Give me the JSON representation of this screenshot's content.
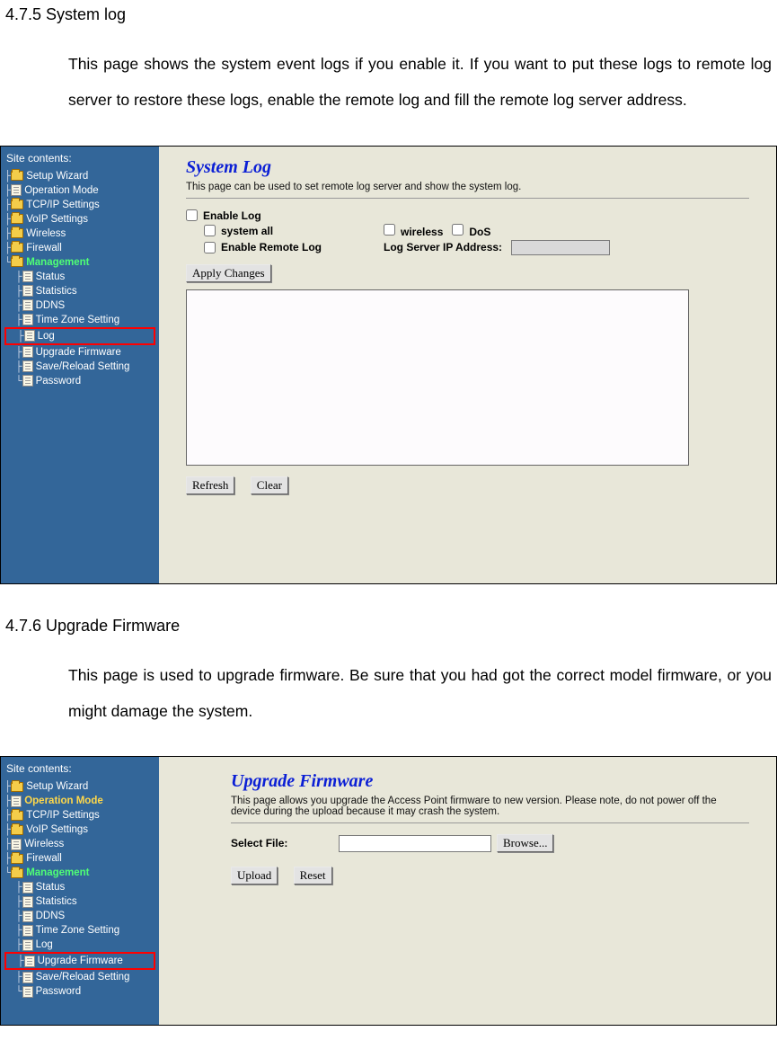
{
  "section1": {
    "heading": "4.7.5 System log",
    "body": "This page shows the system event logs if you enable it. If you want to put these logs to remote log server to restore these logs, enable the remote log and fill the remote log server address."
  },
  "section2": {
    "heading": "4.7.6 Upgrade Firmware",
    "body": "This page is used to upgrade firmware. Be sure that you had got the correct model firmware, or you might damage the system."
  },
  "sidebar": {
    "title": "Site contents:",
    "items": [
      {
        "label": "Setup Wizard",
        "type": "folder",
        "style": "normal"
      },
      {
        "label": "Operation Mode",
        "type": "file",
        "style": "normal"
      },
      {
        "label": "TCP/IP Settings",
        "type": "folder",
        "style": "normal"
      },
      {
        "label": "VoIP Settings",
        "type": "folder",
        "style": "normal"
      },
      {
        "label": "Wireless",
        "type": "folder",
        "style": "normal"
      },
      {
        "label": "Firewall",
        "type": "folder",
        "style": "normal"
      },
      {
        "label": "Management",
        "type": "folder",
        "style": "green"
      }
    ],
    "mgmt_children": [
      {
        "label": "Status"
      },
      {
        "label": "Statistics"
      },
      {
        "label": "DDNS"
      },
      {
        "label": "Time Zone Setting"
      },
      {
        "label": "Log"
      },
      {
        "label": "Upgrade Firmware"
      },
      {
        "label": "Save/Reload Setting"
      },
      {
        "label": "Password"
      }
    ]
  },
  "sidebar2": {
    "op_mode_style": "orange",
    "wireless_type": "file"
  },
  "syslog": {
    "title": "System Log",
    "desc": "This page can be used to set remote log server and show the system log.",
    "enable_log": "Enable Log",
    "system_all": "system all",
    "wireless": "wireless",
    "dos": "DoS",
    "enable_remote": "Enable Remote Log",
    "server_addr": "Log Server IP Address:",
    "apply": "Apply Changes",
    "refresh": "Refresh",
    "clear": "Clear"
  },
  "firmware": {
    "title": "Upgrade Firmware",
    "desc": "This page allows you upgrade the Access Point firmware to new version. Please note, do not power off the device during the upload because it may crash the system.",
    "select_file": "Select File:",
    "browse": "Browse...",
    "upload": "Upload",
    "reset": "Reset"
  }
}
